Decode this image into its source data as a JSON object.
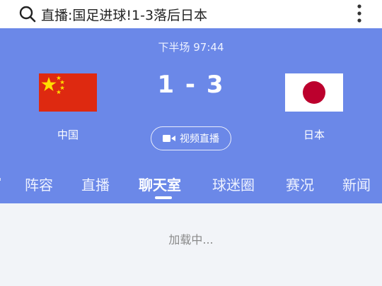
{
  "search": {
    "text": "直播:国足进球!1-3落后日本"
  },
  "match": {
    "period": "下半场 97:44",
    "score": "1 - 3",
    "home_team": "中国",
    "away_team": "日本",
    "video_button_label": "视频直播"
  },
  "tabs": [
    {
      "label": "阵容"
    },
    {
      "label": "直播"
    },
    {
      "label": "聊天室",
      "active": true
    },
    {
      "label": "球迷圈"
    },
    {
      "label": "赛况"
    },
    {
      "label": "新闻"
    }
  ],
  "content": {
    "loading_text": "加载中..."
  },
  "colors": {
    "hero_bg": "#6b88e8",
    "cn_red": "#de2910",
    "cn_star": "#ffde00",
    "jp_red": "#bc002d"
  }
}
